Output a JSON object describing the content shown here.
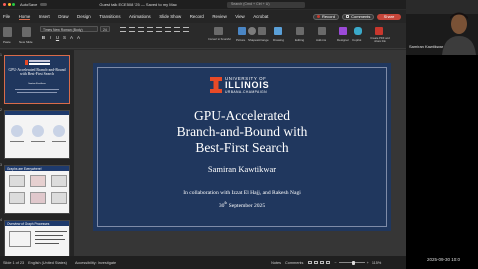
{
  "titlebar": {
    "autosave": "AutoSave",
    "doc_title": "Guest talk ECE508 '25 — Saved to my Mac",
    "search": "Search (Cmd + Ctrl + U)"
  },
  "menu": [
    "File",
    "Home",
    "Insert",
    "Draw",
    "Design",
    "Transitions",
    "Animations",
    "Slide Show",
    "Record",
    "Review",
    "View",
    "Acrobat"
  ],
  "ribbon": {
    "font_name": "Times New Roman (Body)",
    "font_size": "24",
    "labels": {
      "paste": "Paste",
      "new_slide": "New Slide",
      "convert": "Convert to SmartArt",
      "picture": "Picture",
      "shapes": "Shapes",
      "arrange": "Arrange",
      "quick_styles": "Quick Styles",
      "drawing": "Drawing",
      "add_ins": "Add-ins",
      "designer": "Designer",
      "copilot": "Copilot",
      "create_pdf": "Create PDF and share link",
      "editing": "Editing"
    },
    "record_btn": "Record",
    "comments_btn": "Comments",
    "share_btn": "Share"
  },
  "thumbnails": [
    {
      "num": "1",
      "title": "GPU-Accelerated Branch-and-Bound with Best-First Search",
      "author": "Samiran Kawtikwar"
    },
    {
      "num": "2",
      "title": "",
      "author": ""
    },
    {
      "num": "3",
      "title": "Graphs are Everywhere!",
      "author": ""
    },
    {
      "num": "4",
      "title": "Overview of Graph Processes",
      "author": ""
    }
  ],
  "slide": {
    "univ_line1": "UNIVERSITY OF",
    "univ_line2": "ILLINOIS",
    "univ_line3": "URBANA-CHAMPAIGN",
    "title_line1": "GPU-Accelerated",
    "title_line2": "Branch-and-Bound with",
    "title_line3": "Best-First Search",
    "author": "Samiran Kawtikwar",
    "collab": "In collaboration with Izzat El Hajj, and Rakesh Nagi",
    "date_day": "30",
    "date_sup": "th",
    "date_rest": " September 2025"
  },
  "statusbar": {
    "slide_info": "Slide 1 of 23",
    "language": "English (United States)",
    "accessibility": "Accessibility: Investigate",
    "notes": "Notes",
    "comments": "Comments",
    "zoom": "115%"
  },
  "video": {
    "name": "Samiran Kawtikwar"
  },
  "clock": "2025-09-30  10:0",
  "colors": {
    "slide_bg": "#20375e",
    "illinois_orange": "#e84a27",
    "record_red": "#c43b2e",
    "share_red": "#c6463a"
  }
}
